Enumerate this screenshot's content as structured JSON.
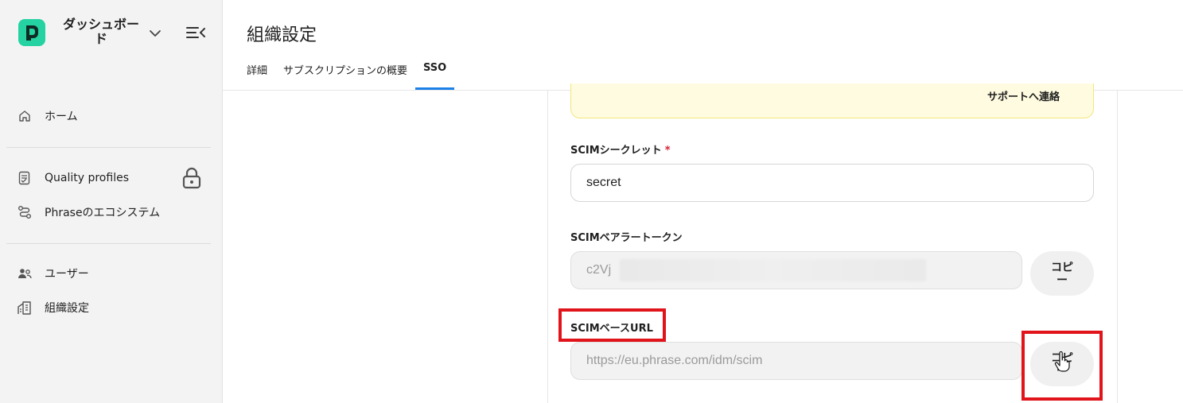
{
  "sidebar": {
    "app_title": "ダッシュボード",
    "items": [
      {
        "label": "ホーム",
        "icon": "home-icon"
      },
      {
        "label": "Quality profiles",
        "icon": "checklist-icon",
        "locked": true
      },
      {
        "label": "Phraseのエコシステム",
        "icon": "route-icon"
      },
      {
        "label": "ユーザー",
        "icon": "users-icon"
      },
      {
        "label": "組織設定",
        "icon": "building-icon"
      }
    ]
  },
  "header": {
    "title": "組織設定",
    "tabs": [
      {
        "label": "詳細",
        "active": false
      },
      {
        "label": "サブスクリプションの概要",
        "active": false
      },
      {
        "label": "SSO",
        "active": true
      }
    ]
  },
  "notice": {
    "link": "サポートへ連絡"
  },
  "form": {
    "scim_secret": {
      "label": "SCIMシークレット",
      "required_mark": "*",
      "value": "secret"
    },
    "scim_bearer_token": {
      "label": "SCIMベアラートークン",
      "value": "c2Vj",
      "copy_label": "コピー"
    },
    "scim_base_url": {
      "label": "SCIMベースURL",
      "value": "https://eu.phrase.com/idm/scim",
      "copy_label": "コピー"
    }
  },
  "colors": {
    "brand": "#24d3a1",
    "tab_active": "#1c80e8",
    "highlight": "#e0141a",
    "notice_bg": "#fefbe0"
  }
}
